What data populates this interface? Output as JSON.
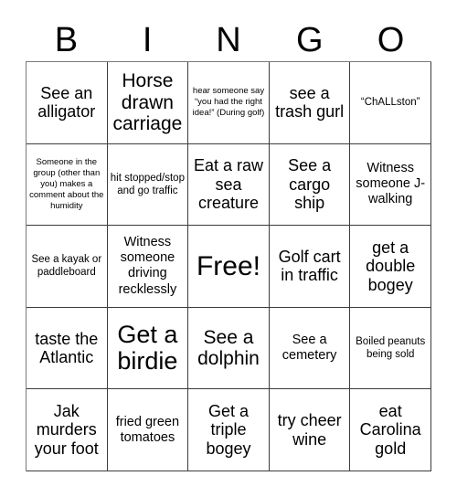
{
  "card": {
    "header_letters": [
      "B",
      "I",
      "N",
      "G",
      "O"
    ],
    "grid": {
      "columns": 5,
      "rows": 5,
      "cells": [
        {
          "text": "See an alligator",
          "size": "lg",
          "free": false
        },
        {
          "text": "Horse drawn carriage",
          "size": "xl",
          "free": false
        },
        {
          "text": "hear someone say “you had the right idea!” (During golf)",
          "size": "xs",
          "free": false
        },
        {
          "text": "see a trash gurl",
          "size": "lg",
          "free": false
        },
        {
          "text": "“ChALLston”",
          "size": "sm",
          "free": false
        },
        {
          "text": "Someone in the group (other than you) makes a comment about the humidity",
          "size": "xs",
          "free": false
        },
        {
          "text": "hit stopped/stop and go traffic",
          "size": "sm",
          "free": false
        },
        {
          "text": "Eat a raw sea creature",
          "size": "lg",
          "free": false
        },
        {
          "text": "See a cargo ship",
          "size": "lg",
          "free": false
        },
        {
          "text": "Witness someone J-walking",
          "size": "md",
          "free": false
        },
        {
          "text": "See a kayak or paddleboard",
          "size": "sm",
          "free": false
        },
        {
          "text": "Witness someone driving recklessly",
          "size": "md",
          "free": false
        },
        {
          "text": "Free!",
          "size": "free",
          "free": true
        },
        {
          "text": "Golf cart in traffic",
          "size": "lg",
          "free": false
        },
        {
          "text": "get a double bogey",
          "size": "lg",
          "free": false
        },
        {
          "text": "taste the Atlantic",
          "size": "lg",
          "free": false
        },
        {
          "text": "Get a birdie",
          "size": "xxl",
          "free": false
        },
        {
          "text": "See a dolphin",
          "size": "xl",
          "free": false
        },
        {
          "text": "See a cemetery",
          "size": "md",
          "free": false
        },
        {
          "text": "Boiled peanuts being sold",
          "size": "sm",
          "free": false
        },
        {
          "text": "Jak murders your foot",
          "size": "lg",
          "free": false
        },
        {
          "text": "fried green tomatoes",
          "size": "md",
          "free": false
        },
        {
          "text": "Get a triple bogey",
          "size": "lg",
          "free": false
        },
        {
          "text": "try cheer wine",
          "size": "lg",
          "free": false
        },
        {
          "text": "eat Carolina gold",
          "size": "lg",
          "free": false
        }
      ]
    }
  }
}
